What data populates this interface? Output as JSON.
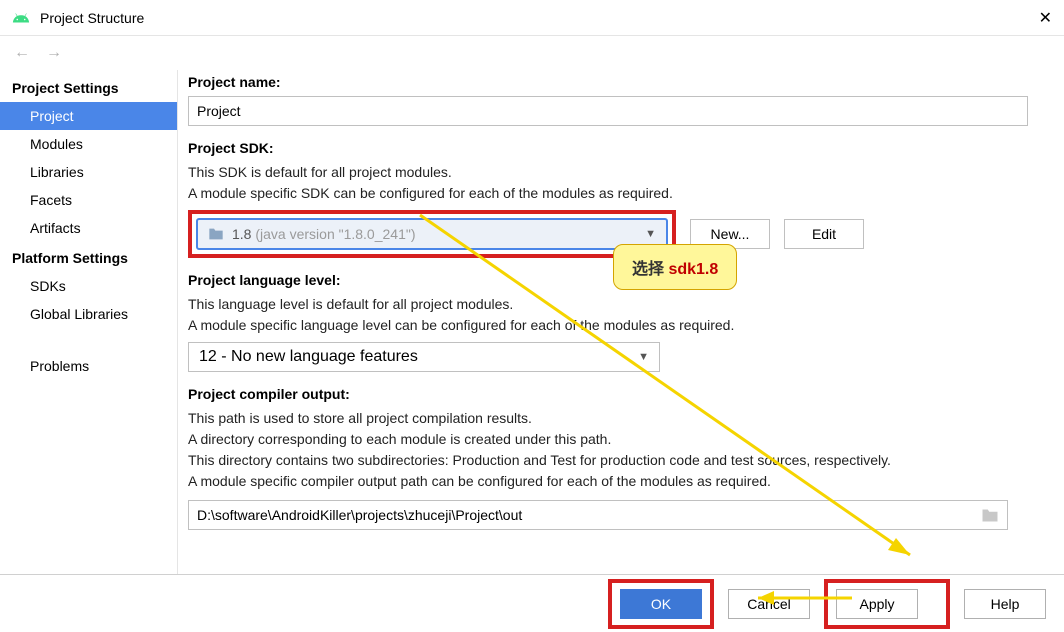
{
  "window": {
    "title": "Project Structure",
    "close": "✕"
  },
  "sidebar": {
    "section1": "Project Settings",
    "section2": "Platform Settings",
    "items1": [
      {
        "label": "Project"
      },
      {
        "label": "Modules"
      },
      {
        "label": "Libraries"
      },
      {
        "label": "Facets"
      },
      {
        "label": "Artifacts"
      }
    ],
    "items2": [
      {
        "label": "SDKs"
      },
      {
        "label": "Global Libraries"
      }
    ],
    "problems": "Problems"
  },
  "content": {
    "projectNameLabel": "Project name:",
    "projectName": "Project",
    "sdkLabel": "Project SDK:",
    "sdkDesc1": "This SDK is default for all project modules.",
    "sdkDesc2": "A module specific SDK can be configured for each of the modules as required.",
    "sdkSelected": "1.8",
    "sdkVersion": "(java version \"1.8.0_241\")",
    "newBtn": "New...",
    "editBtn": "Edit",
    "langLabel": "Project language level:",
    "langDesc1": "This language level is default for all project modules.",
    "langDesc2": "A module specific language level can be configured for each of the modules as required.",
    "langSelected": "12 - No new language features",
    "outLabel": "Project compiler output:",
    "outDesc1": "This path is used to store all project compilation results.",
    "outDesc2": "A directory corresponding to each module is created under this path.",
    "outDesc3": "This directory contains two subdirectories: Production and Test for production code and test sources, respectively.",
    "outDesc4": "A module specific compiler output path can be configured for each of the modules as required.",
    "outPath": "D:\\software\\AndroidKiller\\projects\\zhuceji\\Project\\out"
  },
  "callout": {
    "text1": "选择 ",
    "text2": "sdk1.8"
  },
  "buttons": {
    "ok": "OK",
    "cancel": "Cancel",
    "apply": "Apply",
    "help": "Help"
  }
}
